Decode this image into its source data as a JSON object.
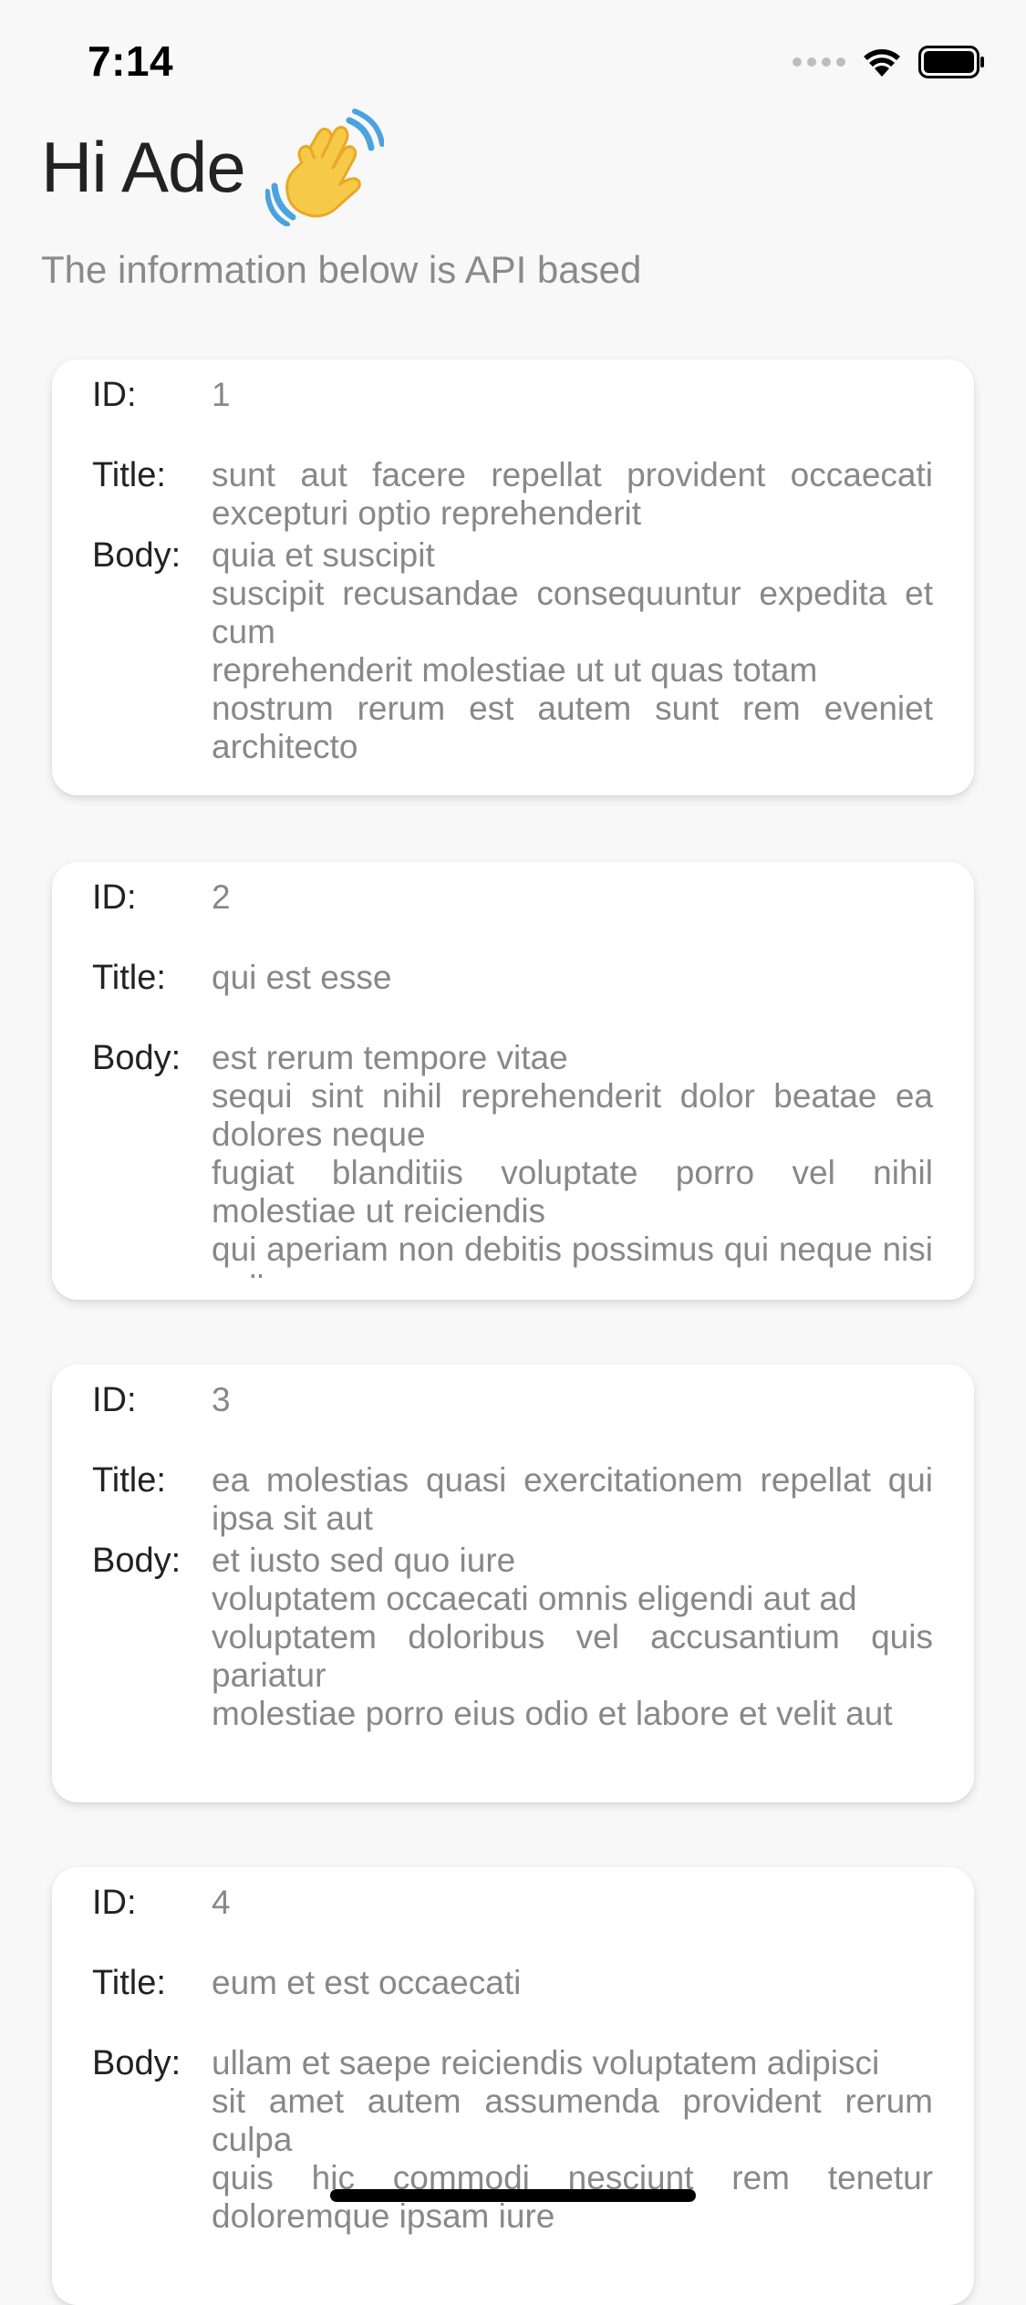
{
  "status_bar": {
    "time": "7:14"
  },
  "header": {
    "greeting": "Hi Ade",
    "subtitle": "The information below is API based"
  },
  "labels": {
    "id": "ID:",
    "title": "Title:",
    "body": "Body:"
  },
  "posts": [
    {
      "id": "1",
      "title": "sunt aut facere repellat provident occaecati excepturi optio reprehenderit",
      "body": "quia et suscipit\nsuscipit recusandae consequuntur expedita et cum\nreprehenderit molestiae ut ut quas totam\nnostrum rerum est autem sunt rem eveniet architecto"
    },
    {
      "id": "2",
      "title": "qui est esse",
      "body": "est rerum tempore vitae\nsequi sint nihil reprehenderit dolor beatae ea dolores neque\nfugiat blanditiis voluptate porro vel nihil molestiae ut reiciendis\nqui aperiam non debitis possimus qui neque nisi nulla"
    },
    {
      "id": "3",
      "title": "ea molestias quasi exercitationem repellat qui ipsa sit aut",
      "body": "et iusto sed quo iure\nvoluptatem occaecati omnis eligendi aut ad\nvoluptatem doloribus vel accusantium quis pariatur\nmolestiae porro eius odio et labore et velit aut"
    },
    {
      "id": "4",
      "title": "eum et est occaecati",
      "body": "ullam et saepe reiciendis voluptatem adipisci\nsit amet autem assumenda provident rerum culpa\nquis hic commodi nesciunt rem tenetur doloremque ipsam iure"
    }
  ],
  "icons": {
    "wave": "waving-hand-icon",
    "wifi": "wifi-icon",
    "battery": "battery-icon",
    "signal": "signal-icon"
  },
  "colors": {
    "background": "#f8f8f8",
    "card": "#ffffff",
    "label": "#222222",
    "value": "#888888",
    "wave_hand": "#f7c948",
    "wave_motion": "#4aa3df"
  }
}
